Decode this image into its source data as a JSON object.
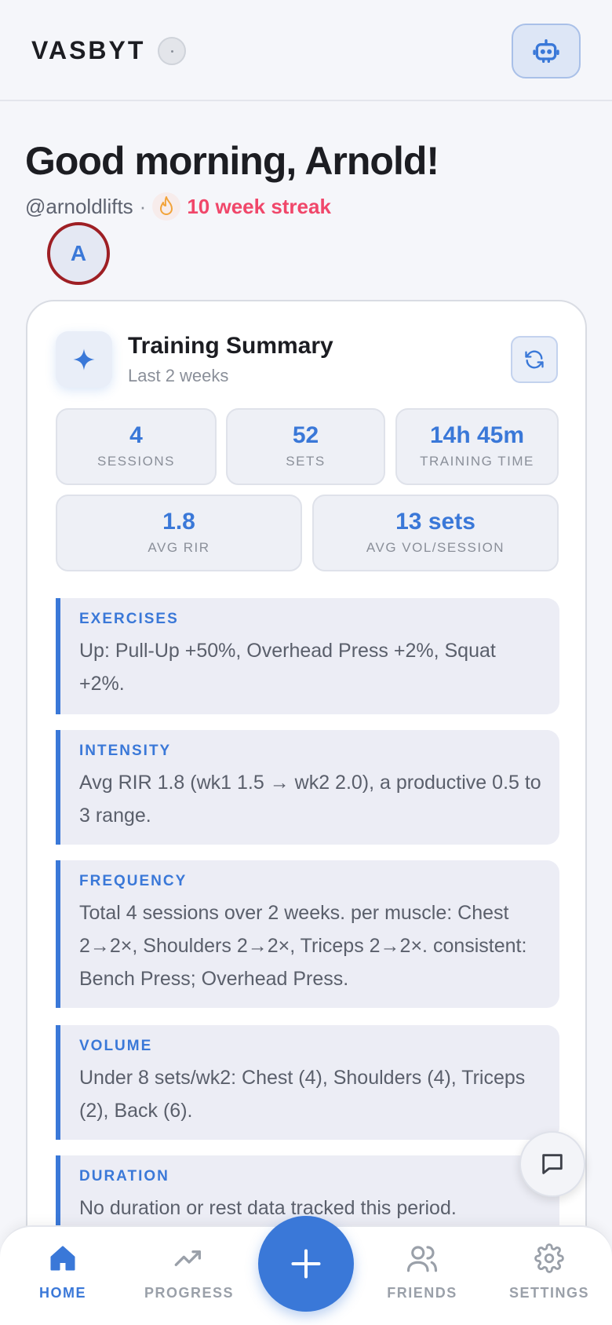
{
  "header": {
    "brand": "VASBYT",
    "assistant_icon": "robot-icon"
  },
  "greeting": {
    "title": "Good morning, Arnold!",
    "handle": "@arnoldlifts",
    "separator": "·",
    "streak_icon": "flame-icon",
    "streak": "10 week streak",
    "avatar_initial": "A"
  },
  "summary": {
    "icon": "sparkle-icon",
    "title": "Training Summary",
    "subtitle": "Last 2 weeks",
    "refresh_icon": "refresh-icon",
    "stats": [
      {
        "value": "4",
        "label": "SESSIONS"
      },
      {
        "value": "52",
        "label": "SETS"
      },
      {
        "value": "14h 45m",
        "label": "TRAINING TIME"
      },
      {
        "value": "1.8",
        "label": "AVG RIR"
      },
      {
        "value": "13 sets",
        "label": "AVG VOL/SESSION"
      }
    ],
    "insights": [
      {
        "label": "EXERCISES",
        "text": "Up: Pull-Up +50%, Overhead Press +2%, Squat +2%."
      },
      {
        "label": "INTENSITY",
        "text": "Avg RIR 1.8 (wk1 1.5 → wk2 2.0), a productive 0.5 to 3 range."
      },
      {
        "label": "FREQUENCY",
        "text": "Total 4 sessions over 2 weeks. per muscle: Chest 2→2×, Shoulders 2→2×, Triceps 2→2×. consistent: Bench Press; Overhead Press."
      },
      {
        "label": "VOLUME",
        "text": "Under 8 sets/wk2: Chest (4), Shoulders (4), Triceps (2), Back (6)."
      },
      {
        "label": "DURATION",
        "text": "No duration or rest data tracked this period."
      }
    ]
  },
  "chat_fab_icon": "chat-bubble-icon",
  "nav": {
    "items": [
      {
        "label": "HOME",
        "icon": "home-icon"
      },
      {
        "label": "PROGRESS",
        "icon": "trending-up-icon"
      },
      {
        "label": "FRIENDS",
        "icon": "users-icon"
      },
      {
        "label": "SETTINGS",
        "icon": "gear-icon"
      }
    ],
    "add_icon": "plus-icon"
  },
  "colors": {
    "accent": "#3a78d8",
    "streak": "#f0476a",
    "avatar_ring": "#9e1f24"
  }
}
